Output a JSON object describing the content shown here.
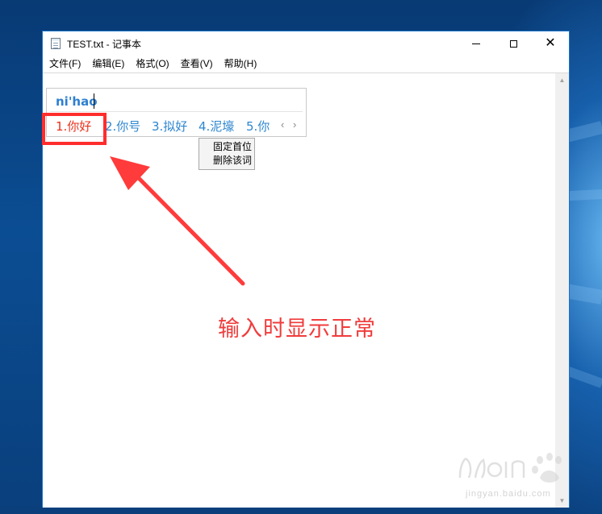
{
  "window": {
    "title": "TEST.txt - 记事本",
    "controls": {
      "minimize": "minimize",
      "maximize": "maximize",
      "close": "✕"
    }
  },
  "menu": {
    "items": [
      "文件(F)",
      "编辑(E)",
      "格式(O)",
      "查看(V)",
      "帮助(H)"
    ]
  },
  "ime": {
    "composition": "ni'hao",
    "candidates": [
      "1.你好",
      "2.你号",
      "3.拟好",
      "4.泥壕",
      "5.你"
    ],
    "selected_index": 0,
    "nav_prev": "‹",
    "nav_next": "›"
  },
  "context_menu": {
    "items": [
      "固定首位",
      "删除该词"
    ]
  },
  "annotation": {
    "caption": "输入时显示正常",
    "color": "#f03c3c"
  },
  "watermark": {
    "url": "jingyan.baidu.com"
  },
  "colors": {
    "window_border": "#1a73c9",
    "candidate": "#2d86cf",
    "candidate_selected": "#e8311e",
    "annotation": "#ff2d2d"
  }
}
